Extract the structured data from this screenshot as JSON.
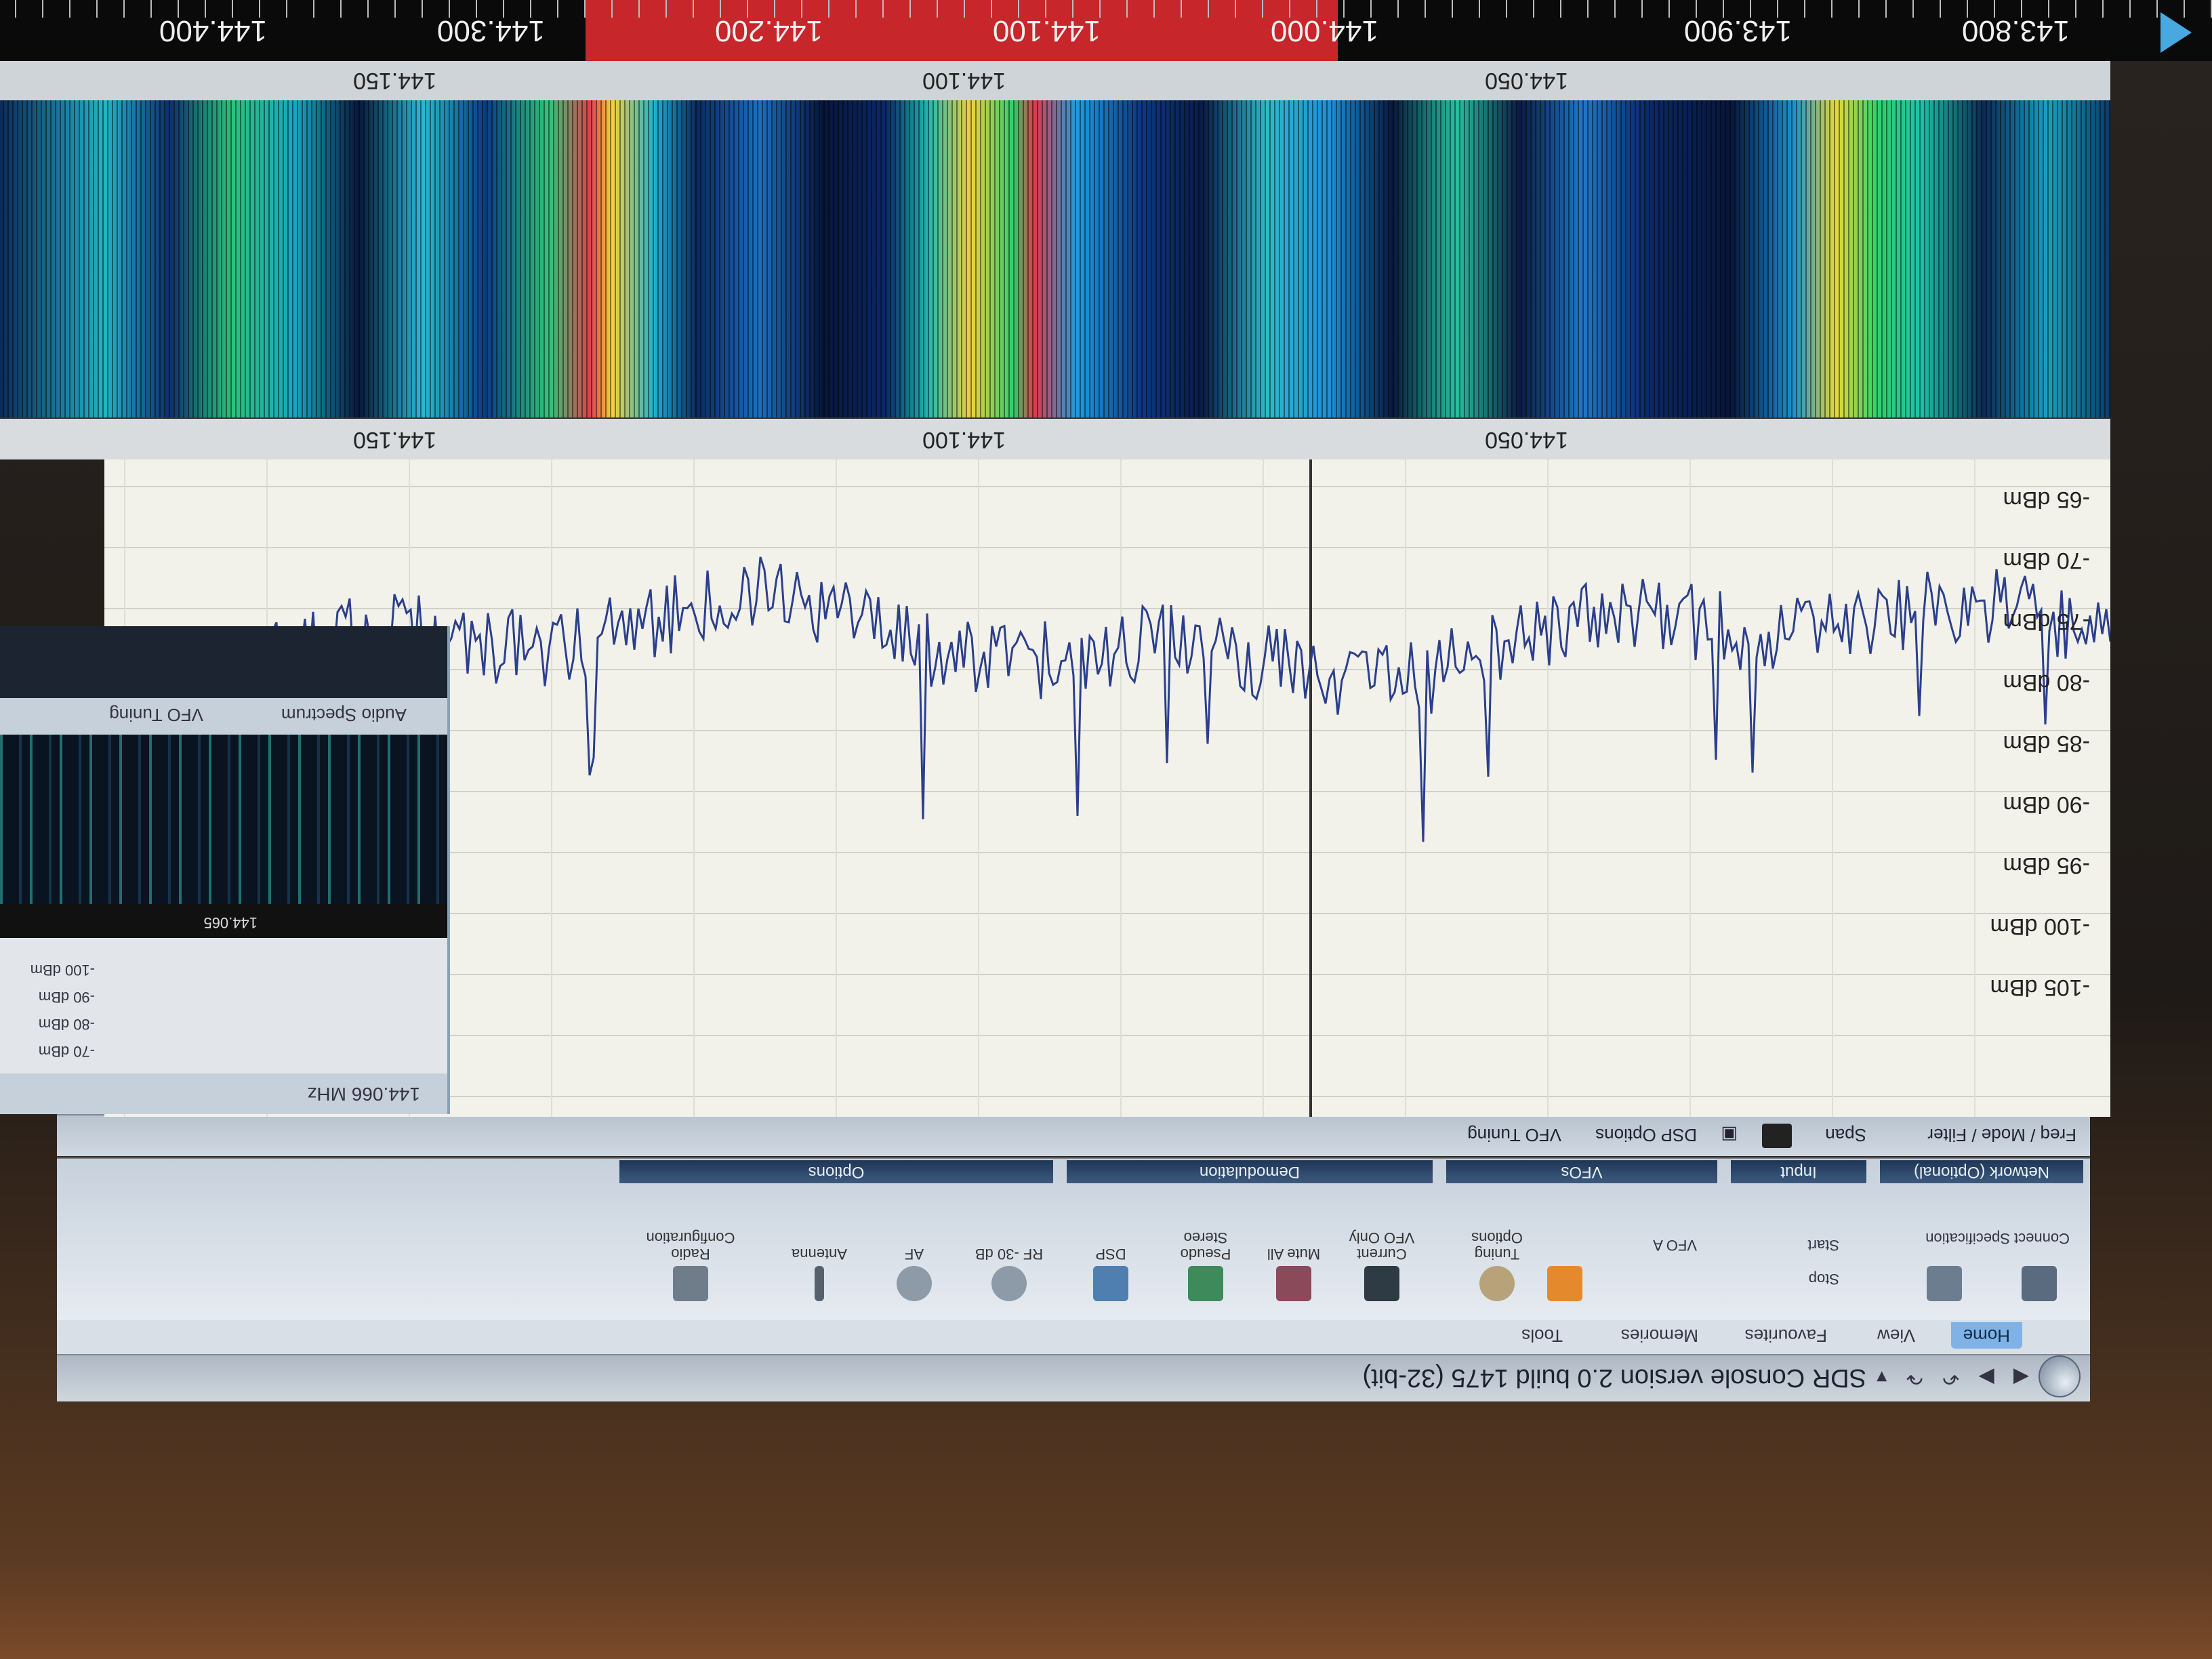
{
  "app": {
    "title": "SDR Console version 2.0 build 1475 (32-bit)"
  },
  "ribbon": {
    "tabs": [
      "Home",
      "View",
      "Favourites",
      "Memories",
      "Tools"
    ],
    "groups": {
      "network_label": "Network (Optional)",
      "connect_label": "Connect Specification",
      "input_label": "Input",
      "input_start": "Start",
      "input_stop": "Stop",
      "vfo_label": "VFOs",
      "vfo_a": "VFO A",
      "tuning_options": "Tuning Options",
      "demod_label": "Demodulation",
      "demod_current_vfo": "Current VFO Only",
      "demod_mute_all": "Mute All",
      "demod_pseudo_stereo": "Pseudo Stereo",
      "options_label": "Options",
      "opt_dsp": "DSP",
      "opt_rf_gain": "RF -30 dB",
      "opt_af": "AF",
      "opt_antenna": "Antenna",
      "opt_radio_config": "Radio Configuration"
    }
  },
  "subbar": {
    "freq_mode": "Freq / Mode / Filter",
    "span": "Span",
    "dsp_options": "DSP Options",
    "vfo_tuning": "VFO Tuning"
  },
  "left_panel": {
    "freq_display": "144.066 MHz",
    "freq_strip": "144.065",
    "tabs": [
      "Audio Spectrum",
      "VFO Tuning"
    ],
    "dbm_rows": [
      "-70 dBm",
      "-80 dBm",
      "-90 dBm",
      "-100 dBm"
    ]
  },
  "spectrum": {
    "dbm_labels": [
      "-65 dBm",
      "-70 dBm",
      "-75 dBm",
      "-80 dBm",
      "-85 dBm",
      "-90 dBm",
      "-95 dBm",
      "-100 dBm",
      "-105 dBm"
    ],
    "freq_labels": [
      "144.050",
      "144.100",
      "144.150"
    ]
  },
  "waterfall": {
    "freq_labels": [
      "144.050",
      "144.100",
      "144.150"
    ]
  },
  "vfo_bar": {
    "freq_labels": [
      "143.800",
      "143.900",
      "144.000",
      "144.100",
      "144.200",
      "144.300",
      "144.400"
    ]
  },
  "colors": {
    "trace": "#2c3f8c",
    "tuned_band": "#c7262a",
    "ribbon_group_header": "#1f3656"
  }
}
